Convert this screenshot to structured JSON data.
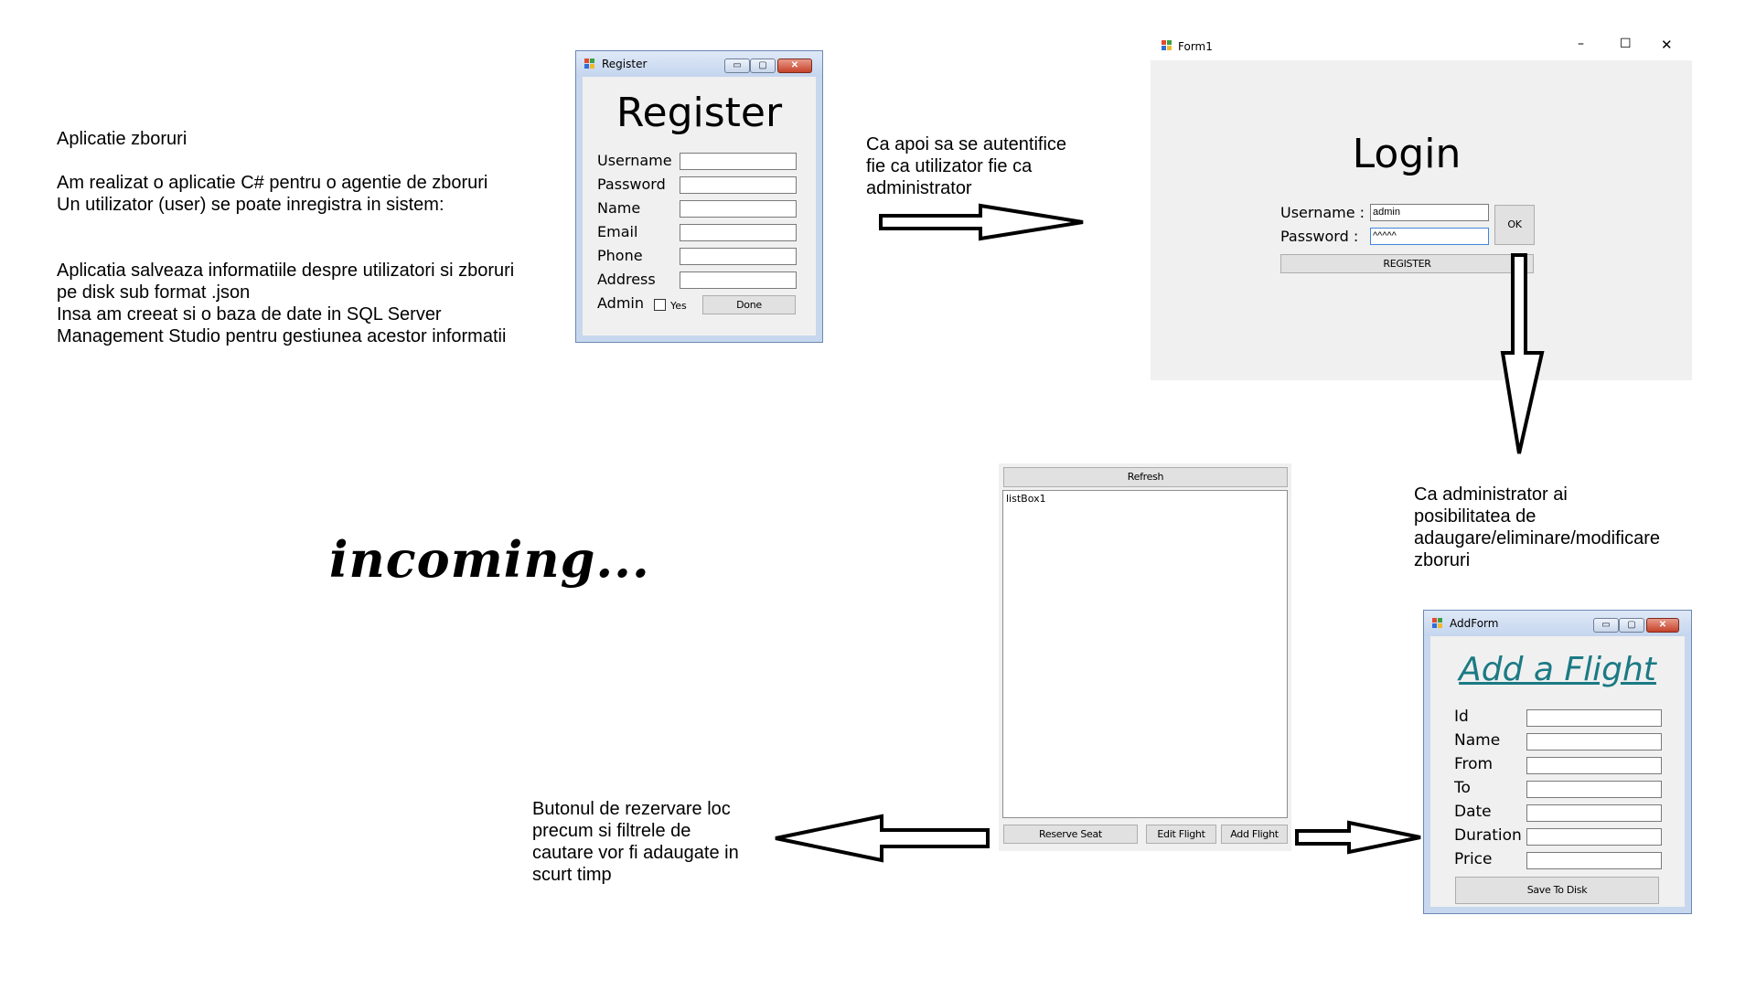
{
  "intro": {
    "title": "Aplicatie zboruri",
    "line1": "Am realizat o aplicatie C# pentru o agentie de zboruri",
    "line2": "Un utilizator (user) se poate inregistra in sistem:",
    "line3": "Aplicatia salveaza informatiile despre utilizatori si zboruri",
    "line4": "pe disk sub format .json",
    "line5": "Insa am creeat si o baza de date in SQL Server",
    "line6": "Management Studio pentru gestiunea acestor informatii"
  },
  "register": {
    "window_title": "Register",
    "heading": "Register",
    "labels": [
      "Username",
      "Password",
      "Name",
      "Email",
      "Phone",
      "Address"
    ],
    "admin_label": "Admin",
    "yes_label": "Yes",
    "done_label": "Done"
  },
  "note_login": {
    "line1": "Ca apoi sa se autentifice",
    "line2": "fie ca utilizator fie ca",
    "line3": "administrator"
  },
  "login": {
    "window_title": "Form1",
    "heading": "Login",
    "username_label": "Username :",
    "password_label": "Password :",
    "username_value": "admin",
    "password_value": "^^^^^",
    "ok_label": "OK",
    "register_label": "REGISTER",
    "minimize_glyph": "–",
    "maximize_glyph": "☐",
    "close_glyph": "✕"
  },
  "note_admin": {
    "line1": "Ca administrator ai",
    "line2": "posibilitatea de",
    "line3": "adaugare/eliminare/modificare",
    "line4": "zboruri"
  },
  "incoming": "incoming...",
  "flights": {
    "refresh_label": "Refresh",
    "listbox_label": "listBox1",
    "reserve_label": "Reserve Seat",
    "edit_label": "Edit Flight",
    "add_label": "Add Flight"
  },
  "note_reserve": {
    "line1": "Butonul de rezervare loc",
    "line2": "precum si filtrele de",
    "line3": "cautare vor fi adaugate in",
    "line4": "scurt timp"
  },
  "addform": {
    "window_title": "AddForm",
    "heading": "Add a Flight",
    "labels": [
      "Id",
      "Name",
      "From",
      "To",
      "Date",
      "Duration",
      "Price"
    ],
    "save_label": "Save To Disk"
  },
  "colors": {
    "heading_teal": "#1b7a84",
    "form_bg": "#f0f0f0",
    "win7_frame": "#c7d7ee"
  },
  "icons": {
    "app": "winforms-app-icon",
    "arrows": [
      "arrow-right",
      "arrow-down",
      "arrow-left",
      "arrow-right"
    ]
  }
}
